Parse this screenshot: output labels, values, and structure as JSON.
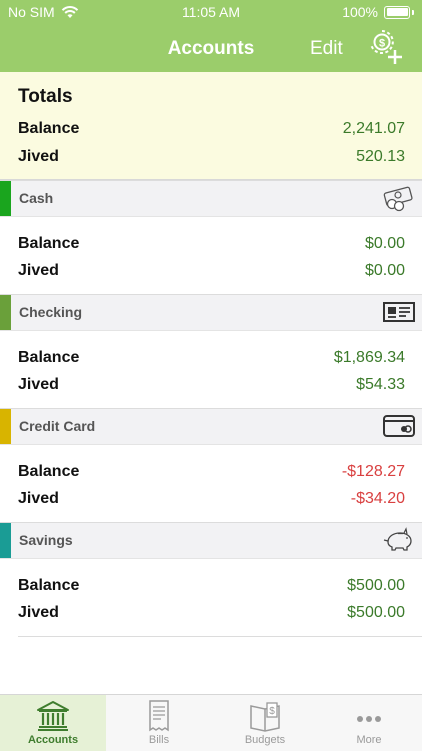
{
  "status_bar": {
    "carrier": "No SIM",
    "time": "11:05 AM",
    "battery": "100%"
  },
  "nav": {
    "title": "Accounts",
    "edit_label": "Edit"
  },
  "totals": {
    "title": "Totals",
    "balance_label": "Balance",
    "balance_value": "2,241.07",
    "jived_label": "Jived",
    "jived_value": "520.13"
  },
  "accounts": [
    {
      "name": "Cash",
      "stripe_color": "#1aa51e",
      "icon": "cash-icon",
      "balance_label": "Balance",
      "balance_value": "$0.00",
      "jived_label": "Jived",
      "jived_value": "$0.00"
    },
    {
      "name": "Checking",
      "stripe_color": "#6aa03a",
      "icon": "check-icon",
      "balance_label": "Balance",
      "balance_value": "$1,869.34",
      "jived_label": "Jived",
      "jived_value": "$54.33"
    },
    {
      "name": "Credit Card",
      "stripe_color": "#d8b400",
      "icon": "credit-card-icon",
      "balance_label": "Balance",
      "balance_value": "-$128.27",
      "jived_label": "Jived",
      "jived_value": "-$34.20"
    },
    {
      "name": "Savings",
      "stripe_color": "#1a9c95",
      "icon": "piggy-bank-icon",
      "balance_label": "Balance",
      "balance_value": "$500.00",
      "jived_label": "Jived",
      "jived_value": "$500.00"
    }
  ],
  "tabs": [
    {
      "label": "Accounts",
      "icon": "bank-icon",
      "active": true
    },
    {
      "label": "Bills",
      "icon": "receipt-icon",
      "active": false
    },
    {
      "label": "Budgets",
      "icon": "budget-book-icon",
      "active": false
    },
    {
      "label": "More",
      "icon": "more-icon",
      "active": false
    }
  ],
  "colors": {
    "header": "#9bcd6b",
    "positive": "#3b7a2a",
    "negative": "#d94040",
    "totals_bg": "#fbfbe0"
  }
}
